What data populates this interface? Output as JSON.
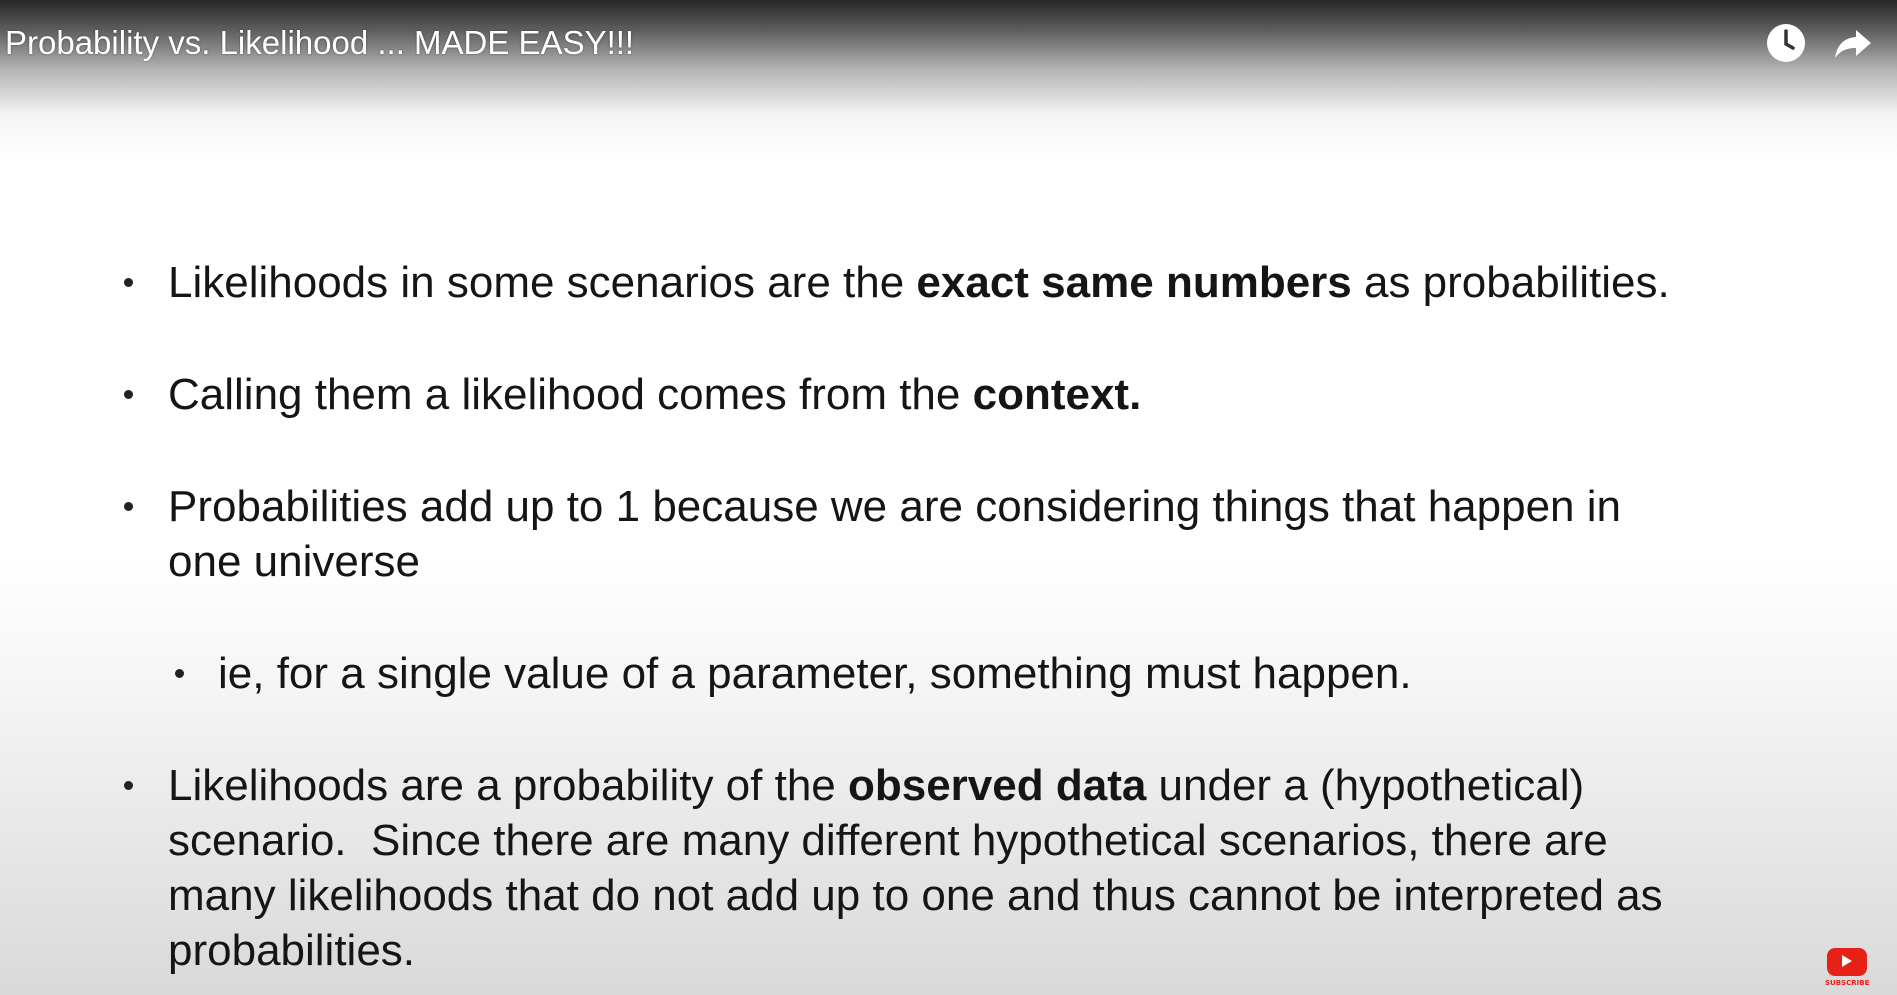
{
  "video": {
    "title": "Probability vs. Likelihood ... MADE EASY!!!"
  },
  "controls": {
    "watch_later_icon": "clock-icon",
    "share_icon": "share-arrow-icon"
  },
  "slide": {
    "bullets": [
      {
        "line1_pre": "Likelihoods in some scenarios are the ",
        "line1_bold": "exact same numbers",
        "line1_post": " as probabilities."
      },
      {
        "line1_pre": "Calling them a likelihood comes from the ",
        "line1_bold": "context."
      },
      {
        "line1": "Probabilities add up to 1 because we are considering things that happen in",
        "line2": "one universe"
      },
      {
        "line1": "ie, for a single value of a parameter, something must happen."
      },
      {
        "line1_pre": "Likelihoods are a probability of the ",
        "line1_bold": "observed data",
        "line1_post": " under a (hypothetical)",
        "line2": "scenario.  Since there are many different hypothetical scenarios, there are",
        "line3": "many likelihoods that do not add up to one and thus cannot be interpreted as",
        "line4": "probabilities."
      }
    ]
  },
  "subscribe": {
    "label": "SUBSCRIBE",
    "icon": "youtube-subscribe-icon",
    "color": "#e62117"
  }
}
